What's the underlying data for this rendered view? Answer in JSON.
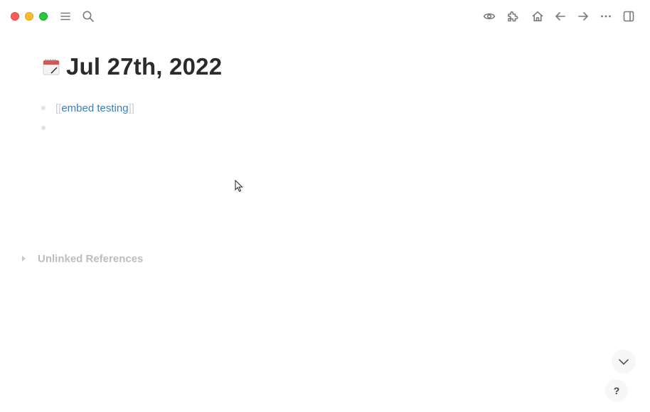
{
  "titlebar": {
    "icons": [
      "menu-icon",
      "search-icon",
      "eye-icon",
      "puzzle-icon",
      "home-icon",
      "arrow-left-icon",
      "arrow-right-icon",
      "more-icon",
      "sidebar-toggle-icon"
    ]
  },
  "page": {
    "title": "Jul 27th, 2022",
    "title_icon": "calendar-icon"
  },
  "blocks": [
    {
      "open_bracket": "[[",
      "ref_text": "embed testing",
      "close_bracket": "]]"
    },
    {
      "text": ""
    }
  ],
  "unlinked_references": {
    "label": "Unlinked References"
  },
  "help": {
    "label": "?"
  },
  "colors": {
    "page_ref": "#3b7fb6",
    "title": "#2b2b2b",
    "muted": "#bdbdbd"
  }
}
